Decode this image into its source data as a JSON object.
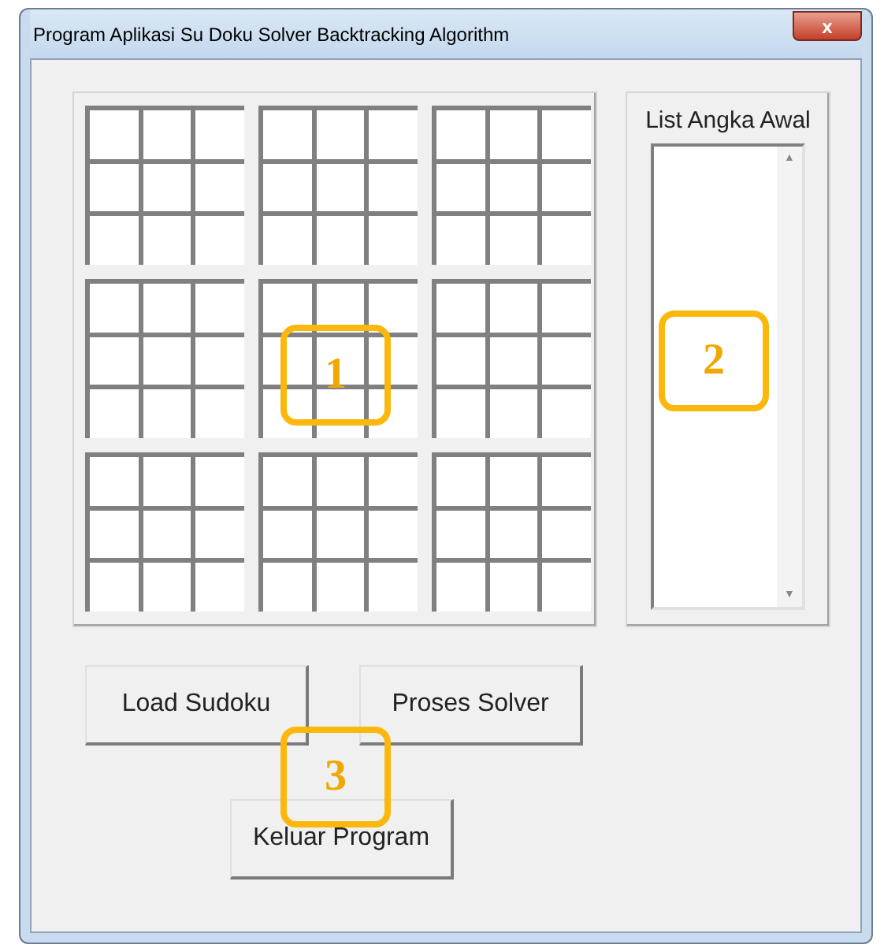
{
  "window": {
    "title": "Program Aplikasi Su Doku Solver Backtracking Algorithm",
    "close": "x"
  },
  "list_panel": {
    "label": "List Angka Awal",
    "scroll_up": "▲",
    "scroll_down": "▼"
  },
  "buttons": [
    {
      "label": "Load Sudoku",
      "kind": "top"
    },
    {
      "label": "Proses Solver",
      "kind": "top"
    },
    {
      "label": "Keluar Program",
      "kind": "bottom"
    }
  ],
  "callouts": [
    {
      "label": "1",
      "kind": "grid"
    },
    {
      "label": "2",
      "kind": "list"
    },
    {
      "label": "3",
      "kind": "buttons"
    }
  ]
}
